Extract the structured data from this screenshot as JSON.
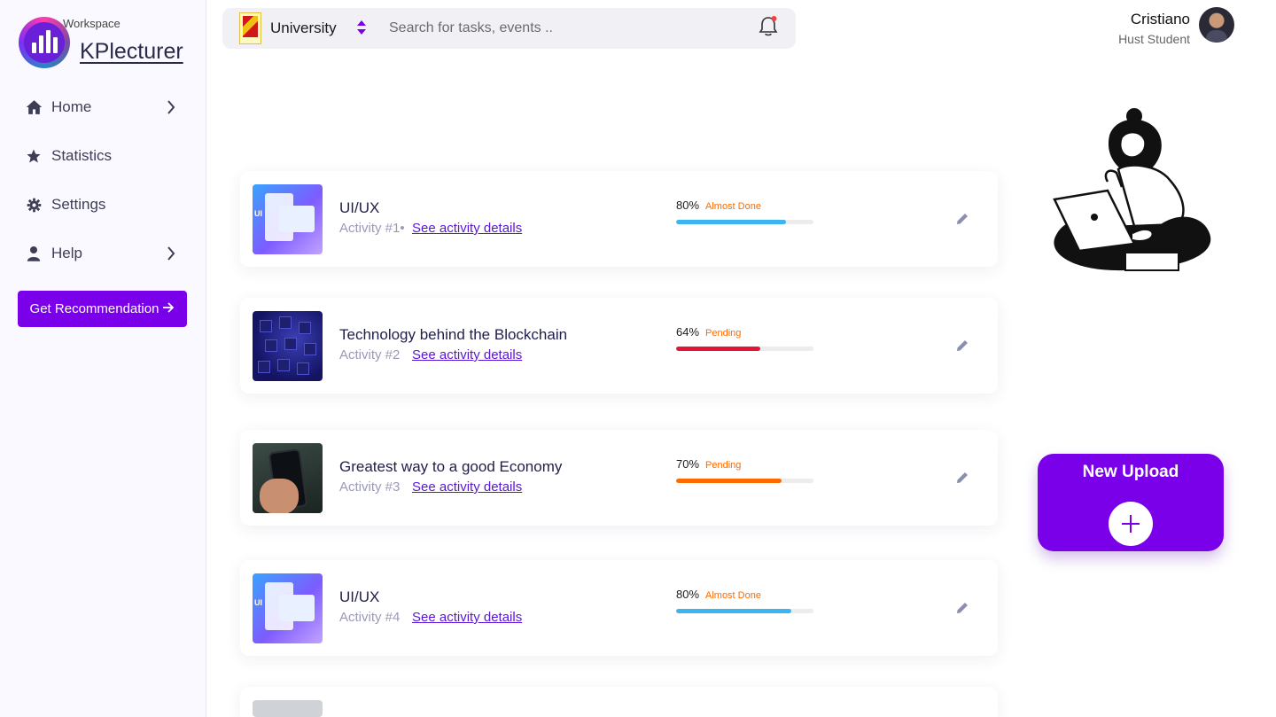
{
  "brand": {
    "workspace_label": "Workspace",
    "name": "KPlecturer"
  },
  "sidebar": {
    "items": [
      {
        "label": "Home",
        "icon": "home-icon",
        "has_chevron": true
      },
      {
        "label": "Statistics",
        "icon": "star-icon",
        "has_chevron": false
      },
      {
        "label": "Settings",
        "icon": "gear-icon",
        "has_chevron": false
      },
      {
        "label": "Help",
        "icon": "user-icon",
        "has_chevron": true
      }
    ],
    "cta_label": "Get Recommendation"
  },
  "topbar": {
    "org_label": "University",
    "search_placeholder": "Search for tasks, events .."
  },
  "user": {
    "name": "Cristiano",
    "role": "Hust Student"
  },
  "activities": [
    {
      "title": "UI/UX",
      "sub": "Activity #1•",
      "link": "See activity details",
      "percent": "80%",
      "status": "Almost Done",
      "progress": 0.8,
      "status_color": "#ff6a00",
      "bar_color": "#3bb5f0",
      "thumb": "ui"
    },
    {
      "title": "Technology behind the Blockchain",
      "sub": "Activity #2",
      "link": "See activity details",
      "percent": "64%",
      "status": "Pending",
      "progress": 0.61,
      "status_color": "#ff6a00",
      "bar_color": "#e5153a",
      "thumb": "block"
    },
    {
      "title": "Greatest way to a good Economy",
      "sub": "Activity #3",
      "link": "See activity details",
      "percent": "70%",
      "status": "Pending",
      "progress": 0.77,
      "status_color": "#ff6a00",
      "bar_color": "#ff6a00",
      "thumb": "eco"
    },
    {
      "title": "UI/UX",
      "sub": "Activity #4",
      "link": "See activity details",
      "percent": "80%",
      "status": "Almost Done",
      "progress": 0.84,
      "status_color": "#ff6a00",
      "bar_color": "#3bb5f0",
      "thumb": "ui"
    }
  ],
  "upload": {
    "title": "New Upload"
  },
  "colors": {
    "accent": "#7a00ea",
    "link": "#5a16d8"
  }
}
